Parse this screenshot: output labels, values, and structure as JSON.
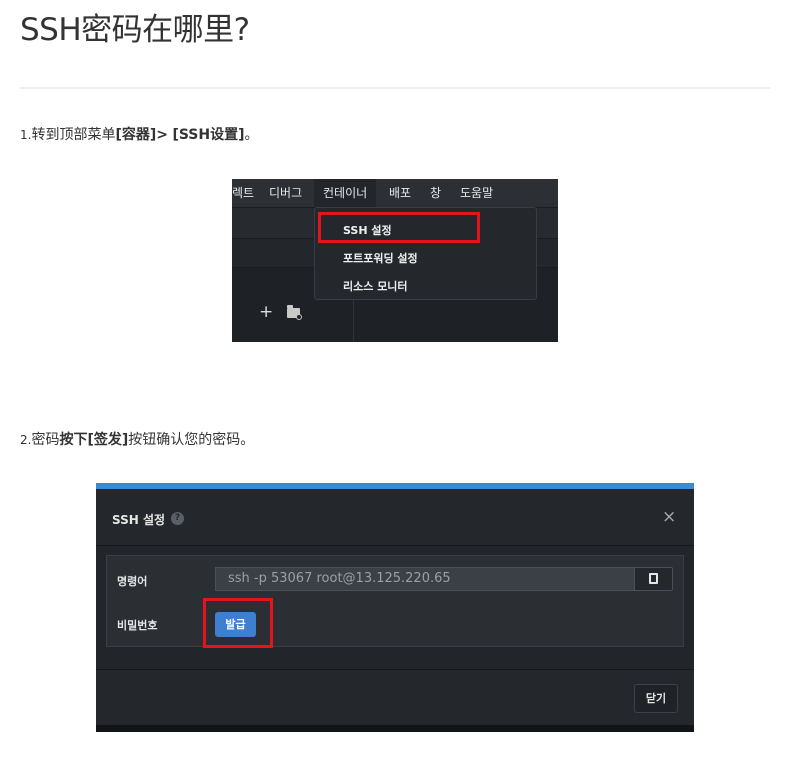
{
  "page": {
    "title": "SSH密码在哪里?",
    "step1": {
      "num": "1.",
      "text_a": "转到顶部菜单",
      "bold_a": "[容器]>",
      "text_b": " ",
      "bold_b": "[SSH设置]",
      "text_c": "。"
    },
    "step2": {
      "num": "2.",
      "text_a": "密码",
      "bold_a": "按下[签发]",
      "text_b": "按钮确认您的密码。"
    }
  },
  "menu_screenshot": {
    "menubar": [
      "렉트",
      "디버그",
      "컨테이너",
      "배포",
      "창",
      "도움말"
    ],
    "active_menu": "컨테이너",
    "toolbar_plus": "+",
    "dropdown_items": [
      "SSH 설정",
      "포트포워딩 설정",
      "리소스 모니터"
    ],
    "highlight_color": "#e3141b"
  },
  "ssh_dialog": {
    "title": "SSH 설정",
    "help_icon": "?",
    "close_icon": "×",
    "command_label": "명령어",
    "command_value": "ssh -p 53067 root@13.125.220.65",
    "password_label": "비밀번호",
    "issue_button": "발급",
    "close_button": "닫기",
    "accent_color": "#3a8bd6",
    "highlight_color": "#e3141b"
  }
}
